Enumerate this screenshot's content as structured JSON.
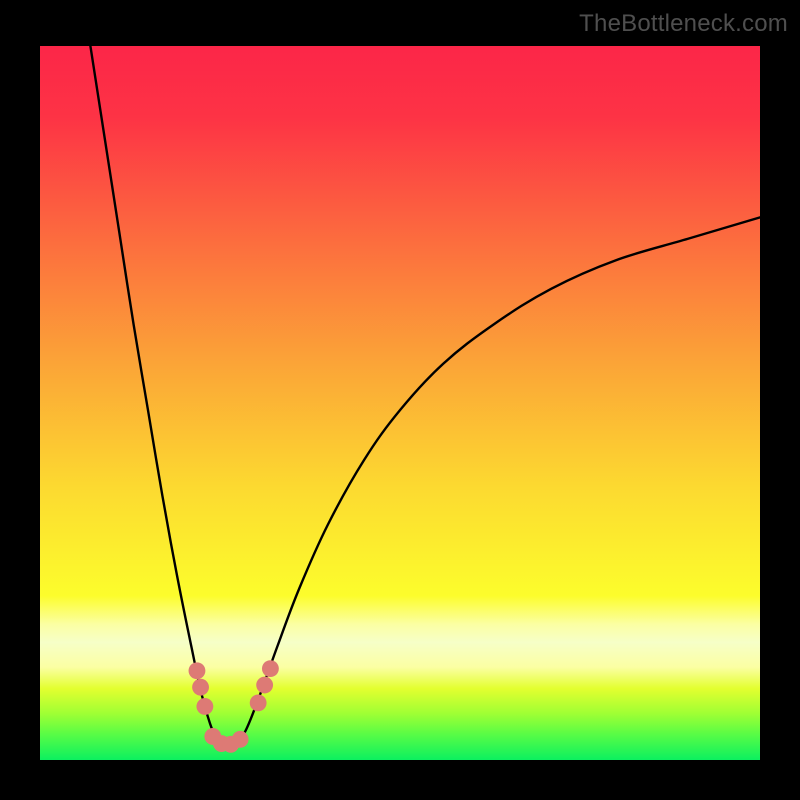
{
  "watermark": "TheBottleneck.com",
  "colors": {
    "background": "#000000",
    "gradient_stops": [
      {
        "offset": 0.0,
        "color": "#fc2648"
      },
      {
        "offset": 0.1,
        "color": "#fd3345"
      },
      {
        "offset": 0.28,
        "color": "#fc6f3e"
      },
      {
        "offset": 0.45,
        "color": "#fba637"
      },
      {
        "offset": 0.62,
        "color": "#fcda30"
      },
      {
        "offset": 0.77,
        "color": "#fcfd2c"
      },
      {
        "offset": 0.81,
        "color": "#fbffa3"
      },
      {
        "offset": 0.835,
        "color": "#f6ffc8"
      },
      {
        "offset": 0.87,
        "color": "#fbffa3"
      },
      {
        "offset": 0.9,
        "color": "#e3ff2f"
      },
      {
        "offset": 0.935,
        "color": "#9fff34"
      },
      {
        "offset": 0.965,
        "color": "#56fc46"
      },
      {
        "offset": 1.0,
        "color": "#0bf05f"
      }
    ],
    "curve": "#000000",
    "marker_fill": "#dd7a75",
    "marker_stroke": "#dd7a75"
  },
  "chart_data": {
    "type": "line",
    "title": "",
    "xlabel": "",
    "ylabel": "",
    "xlim": [
      0,
      100
    ],
    "ylim": [
      0,
      100
    ],
    "curve": {
      "comment": "y(x) approximate; minimum near x≈25, y≈2; left branch rises to y≈100 at x≈7; right branch rises slowly to y≈76 at x=100",
      "points": [
        {
          "x": 7.0,
          "y": 100.0
        },
        {
          "x": 9.0,
          "y": 87.0
        },
        {
          "x": 11.0,
          "y": 74.0
        },
        {
          "x": 13.0,
          "y": 61.0
        },
        {
          "x": 15.0,
          "y": 49.0
        },
        {
          "x": 17.0,
          "y": 37.0
        },
        {
          "x": 19.0,
          "y": 26.0
        },
        {
          "x": 21.0,
          "y": 16.0
        },
        {
          "x": 22.5,
          "y": 9.0
        },
        {
          "x": 24.0,
          "y": 4.0
        },
        {
          "x": 25.0,
          "y": 2.2
        },
        {
          "x": 26.0,
          "y": 2.0
        },
        {
          "x": 27.0,
          "y": 2.2
        },
        {
          "x": 28.5,
          "y": 4.0
        },
        {
          "x": 30.5,
          "y": 9.0
        },
        {
          "x": 33.0,
          "y": 16.0
        },
        {
          "x": 36.0,
          "y": 24.0
        },
        {
          "x": 40.0,
          "y": 33.0
        },
        {
          "x": 45.0,
          "y": 42.0
        },
        {
          "x": 50.0,
          "y": 49.0
        },
        {
          "x": 56.0,
          "y": 55.5
        },
        {
          "x": 63.0,
          "y": 61.0
        },
        {
          "x": 71.0,
          "y": 66.0
        },
        {
          "x": 80.0,
          "y": 70.0
        },
        {
          "x": 90.0,
          "y": 73.0
        },
        {
          "x": 100.0,
          "y": 76.0
        }
      ]
    },
    "markers": [
      {
        "x": 21.8,
        "y": 12.5,
        "r": 1.3
      },
      {
        "x": 22.3,
        "y": 10.2,
        "r": 1.3
      },
      {
        "x": 22.9,
        "y": 7.5,
        "r": 1.3
      },
      {
        "x": 24.0,
        "y": 3.3,
        "r": 1.3
      },
      {
        "x": 25.2,
        "y": 2.3,
        "r": 1.3
      },
      {
        "x": 26.5,
        "y": 2.2,
        "r": 1.3
      },
      {
        "x": 27.8,
        "y": 2.9,
        "r": 1.3
      },
      {
        "x": 30.3,
        "y": 8.0,
        "r": 1.3
      },
      {
        "x": 31.2,
        "y": 10.5,
        "r": 1.3
      },
      {
        "x": 32.0,
        "y": 12.8,
        "r": 1.3
      }
    ]
  }
}
